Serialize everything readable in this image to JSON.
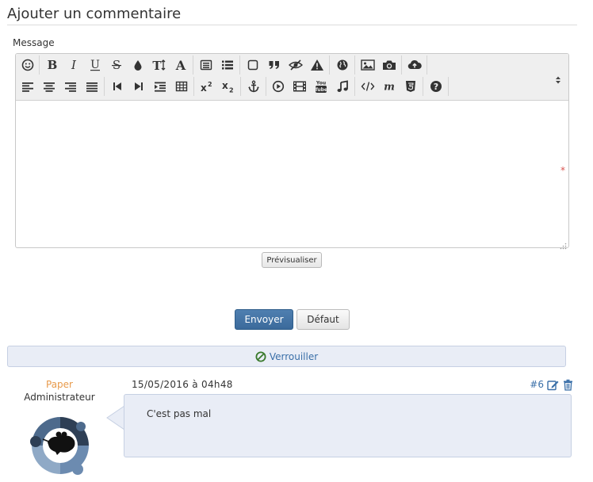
{
  "form": {
    "title": "Ajouter un commentaire",
    "message_label": "Message",
    "message_value": "",
    "required_marker": "*",
    "preview_label": "Prévisualiser",
    "send_label": "Envoyer",
    "default_label": "Défaut"
  },
  "toolbar": {
    "row1": [
      "smiley-icon",
      "bold-icon",
      "italic-icon",
      "underline-icon",
      "strikethrough-icon",
      "color-drop-icon",
      "font-size-icon",
      "font-face-icon",
      "quote-box-icon",
      "list-icon",
      "box-icon",
      "blockquote-icon",
      "spoiler-icon",
      "warning-icon",
      "globe-link-icon",
      "image-icon",
      "camera-icon",
      "upload-cloud-icon"
    ],
    "row2": [
      "align-left-icon",
      "align-center-icon",
      "align-right-icon",
      "justify-icon",
      "skip-back-icon",
      "skip-forward-icon",
      "indent-icon",
      "table-icon",
      "superscript-icon",
      "subscript-icon",
      "anchor-icon",
      "play-icon",
      "film-icon",
      "youtube-icon",
      "music-icon",
      "code-icon",
      "math-icon",
      "html5-icon",
      "help-icon"
    ]
  },
  "moderation": {
    "lock_label": "Verrouiller",
    "lock_color": "#3a7a2c"
  },
  "post": {
    "author": "Paper",
    "role": "Administrateur",
    "date": "15/05/2016 à 04h48",
    "number": "#6",
    "content": "C'est pas mal",
    "author_color": "#e89a4a",
    "link_color": "#3a6fa8"
  }
}
